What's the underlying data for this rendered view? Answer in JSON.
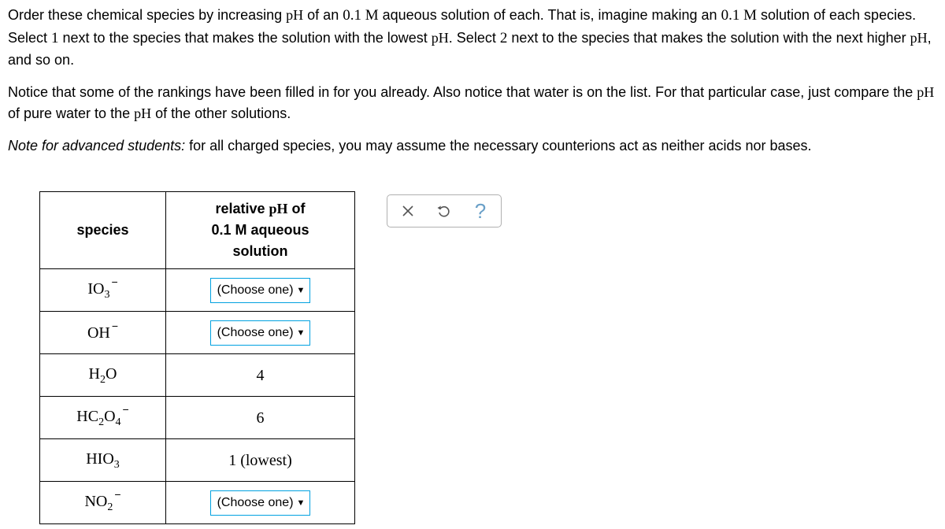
{
  "question": {
    "p1_a": "Order these chemical species by increasing ",
    "ph": "pH",
    "p1_b": " of an ",
    "conc": "0.1 M",
    "p1_c": " aqueous solution of each. That is, imagine making an ",
    "p1_d": " solution of each species. Select ",
    "one": "1",
    "p1_e": " next to the species that makes the solution with the lowest ",
    "p1_f": ". Select ",
    "two": "2",
    "p1_g": " next to the species that makes the solution with the next higher ",
    "p1_h": ", and so on.",
    "p2_a": "Notice that some of the rankings have been filled in for you already. Also notice that water is on the list. For that particular case, just compare the ",
    "p2_b": " of pure water to the ",
    "p2_c": " of the other solutions.",
    "p3_a": "Note for advanced students:",
    "p3_b": " for all charged species, you may assume the necessary counterions act as neither acids nor bases."
  },
  "table": {
    "header_species": "species",
    "header_value_a": "relative ",
    "header_value_b": " of",
    "header_value_c": "0.1 M aqueous solution",
    "rows": [
      {
        "type": "dropdown"
      },
      {
        "type": "dropdown"
      },
      {
        "type": "fixed",
        "value": "4"
      },
      {
        "type": "fixed",
        "value": "6"
      },
      {
        "type": "fixed",
        "value": "1 (lowest)"
      },
      {
        "type": "dropdown"
      }
    ]
  },
  "dropdown_label": "(Choose one)",
  "species_formulas": {
    "r0": {
      "base": "IO",
      "sub": "3",
      "charge": "−"
    },
    "r1": {
      "base": "OH",
      "sub": "",
      "charge": "−"
    },
    "r2": {
      "base": "H",
      "sub": "2",
      "base2": "O"
    },
    "r3": {
      "base": "HC",
      "sub": "2",
      "base2": "O",
      "sub2": "4",
      "charge": "−"
    },
    "r4": {
      "base": "HIO",
      "sub": "3"
    },
    "r5": {
      "base": "NO",
      "sub": "2",
      "charge": "−"
    }
  }
}
